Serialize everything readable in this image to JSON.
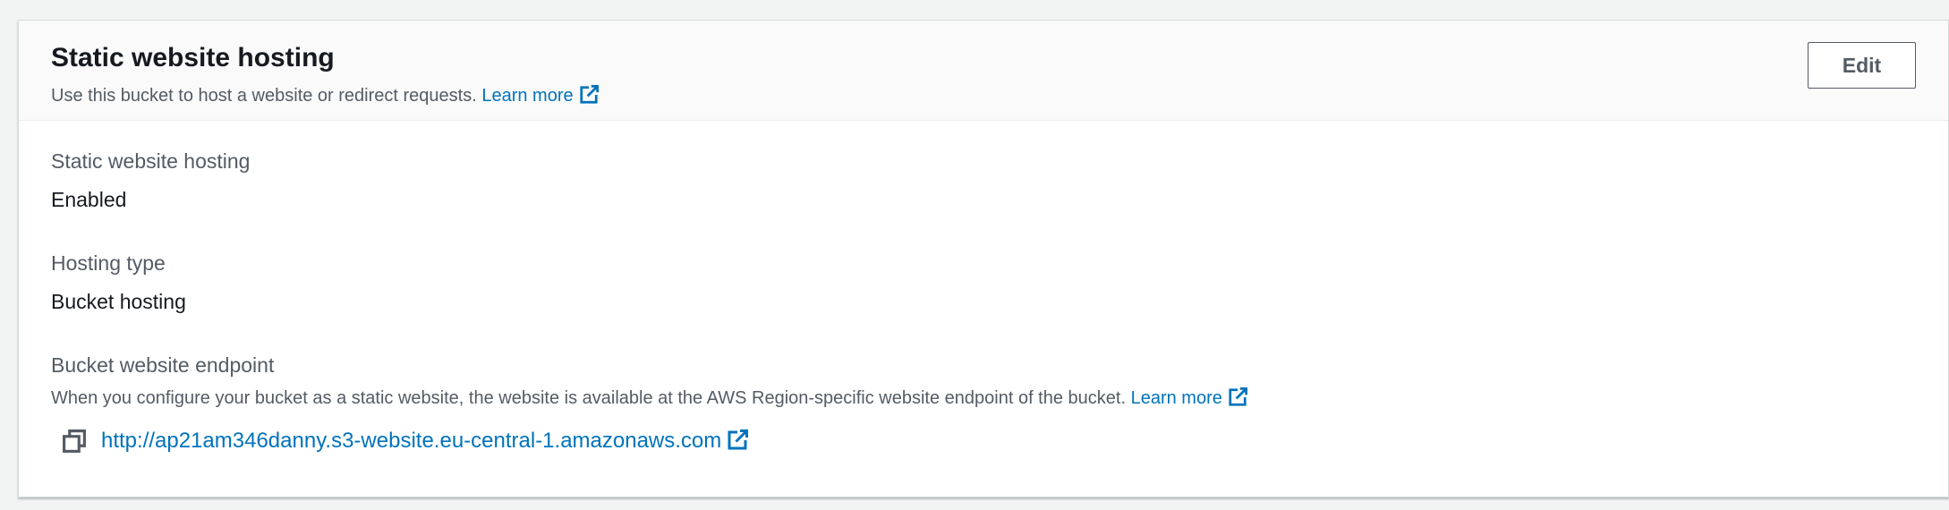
{
  "panel": {
    "title": "Static website hosting",
    "description": "Use this bucket to host a website or redirect requests.",
    "learn_more": "Learn more",
    "edit_label": "Edit"
  },
  "fields": {
    "hosting": {
      "label": "Static website hosting",
      "value": "Enabled"
    },
    "hosting_type": {
      "label": "Hosting type",
      "value": "Bucket hosting"
    },
    "endpoint": {
      "label": "Bucket website endpoint",
      "description": "When you configure your bucket as a static website, the website is available at the AWS Region-specific website endpoint of the bucket.",
      "learn_more": "Learn more",
      "url": "http://ap21am346danny.s3-website.eu-central-1.amazonaws.com"
    }
  },
  "icons": {
    "external_link": "external-link-icon",
    "copy": "copy-icon"
  },
  "colors": {
    "link": "#0073bb",
    "heading": "#16191f",
    "secondary_text": "#545b64"
  }
}
